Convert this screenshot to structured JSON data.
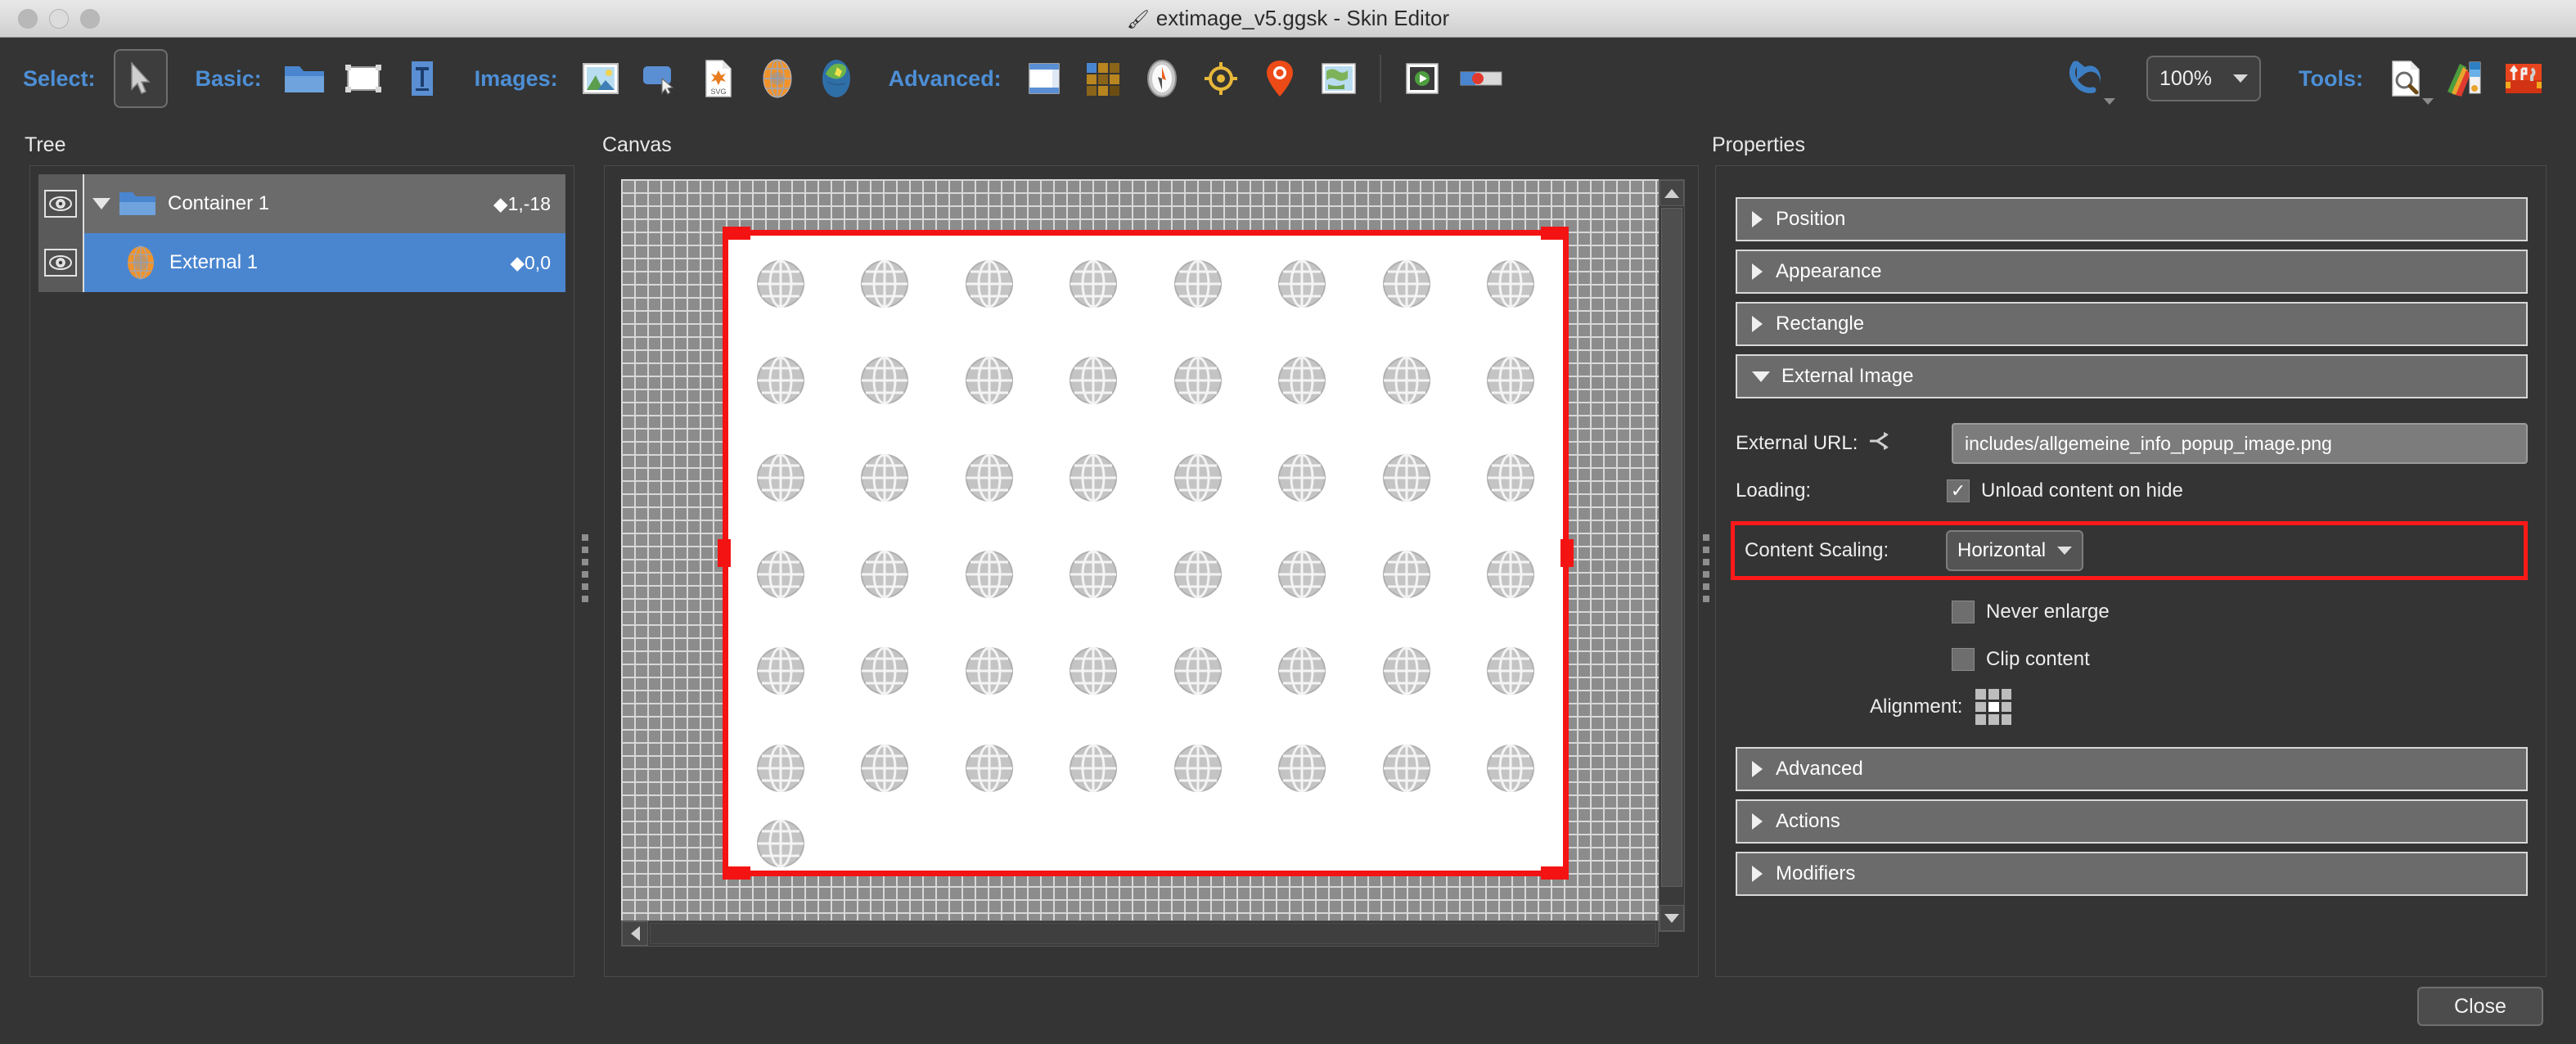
{
  "window": {
    "title": "extimage_v5.ggsk - Skin Editor",
    "title_icon": "skin-editor-app-icon",
    "traffic_lights": [
      "close",
      "minimize",
      "maximize"
    ]
  },
  "toolbar": {
    "groups": [
      {
        "label": "Select:",
        "items": [
          {
            "name": "pointer-tool",
            "selected": true
          }
        ]
      },
      {
        "label": "Basic:",
        "items": [
          {
            "name": "container-tool"
          },
          {
            "name": "rectangle-tool"
          },
          {
            "name": "text-tool"
          }
        ]
      },
      {
        "label": "Images:",
        "items": [
          {
            "name": "image-tool"
          },
          {
            "name": "button-tool"
          },
          {
            "name": "svg-tool"
          },
          {
            "name": "external-image-tool"
          },
          {
            "name": "map-tool"
          }
        ]
      },
      {
        "label": "Advanced:",
        "items": [
          {
            "name": "panorama-tool"
          },
          {
            "name": "thumbnail-grid-tool"
          },
          {
            "name": "compass-tool"
          },
          {
            "name": "radar-tool"
          },
          {
            "name": "hotspot-tool"
          },
          {
            "name": "worldmap-tool"
          },
          {
            "name": "video-tool"
          },
          {
            "name": "progressbar-tool"
          }
        ]
      }
    ],
    "undo_label": "undo",
    "zoom_value": "100%",
    "tools_label": "Tools:",
    "tools_items": [
      {
        "name": "preview-tool"
      },
      {
        "name": "color-palette-tool"
      },
      {
        "name": "toolbox-tool"
      }
    ]
  },
  "tree": {
    "title": "Tree",
    "rows": [
      {
        "name": "Container 1",
        "coords": "1,-18",
        "icon": "folder-icon",
        "expanded": true,
        "selected": false,
        "depth": 0
      },
      {
        "name": "External 1",
        "coords": "0,0",
        "icon": "globe-icon",
        "expanded": false,
        "selected": true,
        "depth": 1
      }
    ],
    "coord_marker": "♦"
  },
  "canvas": {
    "title": "Canvas",
    "selection_color": "#f41313",
    "background_pattern": "checkered-grid",
    "artboard_content": "globe-icon-tile",
    "tile_columns": 8,
    "tile_rows": 6
  },
  "properties": {
    "title": "Properties",
    "sections": [
      {
        "label": "Position",
        "expanded": false
      },
      {
        "label": "Appearance",
        "expanded": false
      },
      {
        "label": "Rectangle",
        "expanded": false
      },
      {
        "label": "External Image",
        "expanded": true
      },
      {
        "label": "Advanced",
        "expanded": false
      },
      {
        "label": "Actions",
        "expanded": false
      },
      {
        "label": "Modifiers",
        "expanded": false
      }
    ],
    "external_image": {
      "url_label": "External URL:",
      "url_icon": "link-branch-icon",
      "url_value": "includes/allgemeine_info_popup_image.png",
      "loading_label": "Loading:",
      "unload_label": "Unload content on hide",
      "unload_checked": true,
      "unload_mark": "✓",
      "scaling_label": "Content Scaling:",
      "scaling_value": "Horizontal",
      "scaling_highlighted": true,
      "highlight_color": "#ff1a1a",
      "never_enlarge_label": "Never enlarge",
      "never_enlarge_checked": false,
      "clip_content_label": "Clip content",
      "clip_content_checked": false,
      "alignment_label": "Alignment:",
      "alignment_selected_cell": 4
    }
  },
  "footer": {
    "close_label": "Close"
  }
}
